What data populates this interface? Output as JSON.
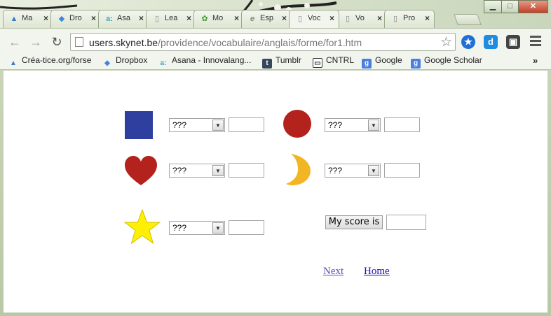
{
  "browser": {
    "tabs": [
      {
        "label": "Ma",
        "icon": "forse-icon",
        "color": "#3b7ac2"
      },
      {
        "label": "Dro",
        "icon": "dropbox-icon",
        "color": "#3d86d9"
      },
      {
        "label": "Asa",
        "icon": "asana-icon",
        "color": "#3aa6c9"
      },
      {
        "label": "Lea",
        "icon": "page-icon",
        "color": "#888888"
      },
      {
        "label": "Mo",
        "icon": "flower-icon",
        "color": "#3a9b2c"
      },
      {
        "label": "Esp",
        "icon": "e-icon",
        "color": "#5a6b55"
      },
      {
        "label": "Voc",
        "icon": "page-icon",
        "color": "#888888",
        "active": true
      },
      {
        "label": "Vo",
        "icon": "page-icon",
        "color": "#888888"
      },
      {
        "label": "Pro",
        "icon": "page-icon",
        "color": "#888888"
      }
    ],
    "window_buttons": {
      "minimize": "▁",
      "maximize": "□",
      "close": "✕"
    },
    "url": {
      "host": "users.skynet.be",
      "path": "/providence/vocabulaire/anglais/forme/for1.htm"
    },
    "bookmarks": [
      {
        "label": "Créa-tice.org/forse",
        "icon": "forse-icon"
      },
      {
        "label": "Dropbox",
        "icon": "dropbox-icon"
      },
      {
        "label": "Asana - Innovalang...",
        "icon": "asana-icon"
      },
      {
        "label": "Tumblr",
        "icon": "tumblr-icon"
      },
      {
        "label": "CNTRL",
        "icon": "cntrl-icon"
      },
      {
        "label": "Google",
        "icon": "google-icon"
      },
      {
        "label": "Google Scholar",
        "icon": "scholar-icon"
      }
    ],
    "bookmarks_overflow": "»"
  },
  "quiz": {
    "placeholder_option": "???",
    "items": [
      {
        "shape": "square",
        "selected": "???",
        "answer": "",
        "color": "#2e3f9f"
      },
      {
        "shape": "circle",
        "selected": "???",
        "answer": "",
        "color": "#b3221d"
      },
      {
        "shape": "heart",
        "selected": "???",
        "answer": "",
        "color": "#b3221d"
      },
      {
        "shape": "crescent",
        "selected": "???",
        "answer": "",
        "color": "#f2b624"
      },
      {
        "shape": "star",
        "selected": "???",
        "answer": "",
        "color": "#ffef00"
      }
    ],
    "score_button": "My score is",
    "score_value": ""
  },
  "links": {
    "next": "Next",
    "home": "Home",
    "visited_color": "#5b4db5",
    "link_color": "#1a0dab"
  }
}
